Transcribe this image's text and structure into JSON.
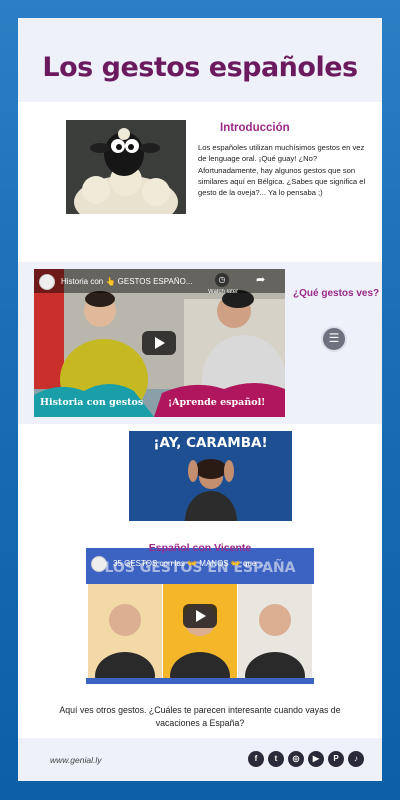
{
  "header": {
    "title": "Los gestos españoles"
  },
  "intro": {
    "heading": "Introducción",
    "paragraph": "Los españoles utilizan muchísimos gestos en vez de lenguage oral. ¡Qué guay! ¿No? Afortunadamente, hay algunos gestos que son similares aquí en Bélgica. ¿Sabes que significa el gesto de la oveja?... Ya lo pensaba ;)"
  },
  "video1": {
    "title": "Historia con 👆 GESTOS ESPAÑO...",
    "watch_later": "Watch later",
    "banner_left": "Historia con gestos",
    "banner_right": "¡Aprende español!",
    "side_question": "¿Qué gestos ves?"
  },
  "caramba": {
    "text": "¡AY, CARAMBA!"
  },
  "video2": {
    "heading": "Español con Vicente",
    "title": "35 GESTOS con las 👐 MANOS 👐 que ...",
    "banner": "LOS GESTOS EN ESPAÑA"
  },
  "outro": {
    "text": "Aquí ves otros gestos. ¿Cuáles te parecen interesante cuando vayas de vacaciones a España?"
  },
  "footer": {
    "url": "www.genial.ly",
    "socials": [
      {
        "icon": "facebook-icon",
        "glyph": "f"
      },
      {
        "icon": "twitter-icon",
        "glyph": "t"
      },
      {
        "icon": "instagram-icon",
        "glyph": "◎"
      },
      {
        "icon": "youtube-icon",
        "glyph": "▶"
      },
      {
        "icon": "pinterest-icon",
        "glyph": "P"
      },
      {
        "icon": "tiktok-icon",
        "glyph": "♪"
      }
    ]
  },
  "colors": {
    "accent": "#9b2a8a",
    "title": "#6b1a5e",
    "background": "#1a6fb5"
  }
}
